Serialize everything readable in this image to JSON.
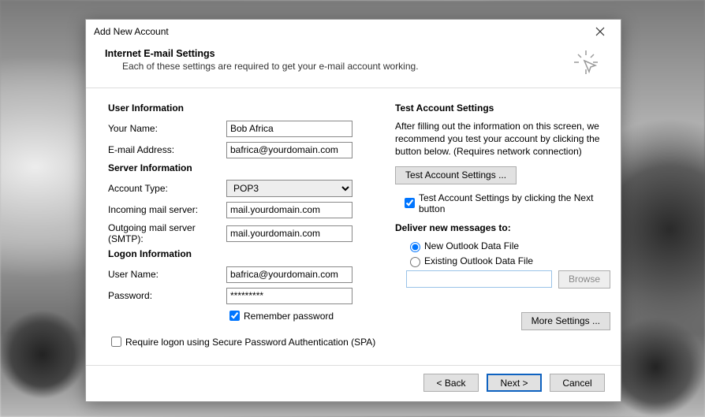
{
  "dialog": {
    "title": "Add New Account",
    "header": "Internet E-mail Settings",
    "subtitle": "Each of these settings are required to get your e-mail account working."
  },
  "userInfo": {
    "heading": "User Information",
    "yourNameLabel": "Your Name:",
    "yourName": "Bob Africa",
    "emailLabel": "E-mail Address:",
    "email": "bafrica@yourdomain.com"
  },
  "serverInfo": {
    "heading": "Server Information",
    "accountTypeLabel": "Account Type:",
    "accountType": "POP3",
    "incomingLabel": "Incoming mail server:",
    "incoming": "mail.yourdomain.com",
    "outgoingLabel": "Outgoing mail server (SMTP):",
    "outgoing": "mail.yourdomain.com"
  },
  "logon": {
    "heading": "Logon Information",
    "userLabel": "User Name:",
    "user": "bafrica@yourdomain.com",
    "passLabel": "Password:",
    "pass": "*********",
    "rememberLabel": "Remember password",
    "spaLabel": "Require logon using Secure Password Authentication (SPA)"
  },
  "test": {
    "heading": "Test Account Settings",
    "desc": "After filling out the information on this screen, we recommend you test your account by clicking the button below. (Requires network connection)",
    "button": "Test Account Settings ...",
    "autoTestLabel": "Test Account Settings by clicking the Next button"
  },
  "deliver": {
    "heading": "Deliver new messages to:",
    "opt1": "New Outlook Data File",
    "opt2": "Existing Outlook Data File",
    "browse": "Browse"
  },
  "buttons": {
    "more": "More Settings ...",
    "back": "< Back",
    "next": "Next >",
    "cancel": "Cancel"
  }
}
